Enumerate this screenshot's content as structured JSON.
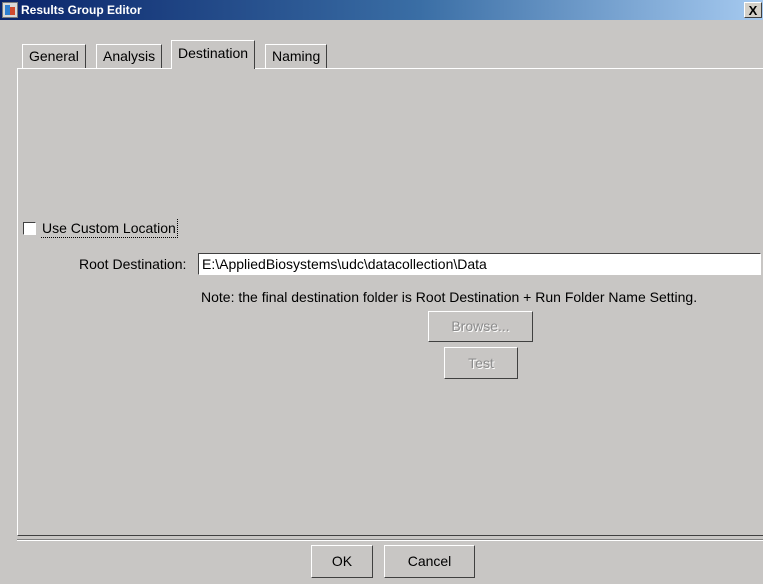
{
  "window": {
    "title": "Results Group Editor",
    "close_glyph": "X",
    "icon": "application-icon"
  },
  "tabs": [
    {
      "label": "General",
      "active": false
    },
    {
      "label": "Analysis",
      "active": false
    },
    {
      "label": "Destination",
      "active": true
    },
    {
      "label": "Naming",
      "active": false
    }
  ],
  "destination": {
    "use_custom_location": {
      "label": "Use Custom Location",
      "checked": false
    },
    "root_destination": {
      "label": "Root Destination:",
      "value": "E:\\AppliedBiosystems\\udc\\datacollection\\Data"
    },
    "note": "Note: the final destination folder is Root Destination + Run Folder Name Setting.",
    "browse_label": "Browse...",
    "test_label": "Test"
  },
  "footer": {
    "ok_label": "OK",
    "cancel_label": "Cancel"
  },
  "colors": {
    "background": "#c8c6c4",
    "titlebar_start": "#0a246a",
    "titlebar_end": "#a6caf0",
    "disabled_text": "#8c8c8c"
  }
}
